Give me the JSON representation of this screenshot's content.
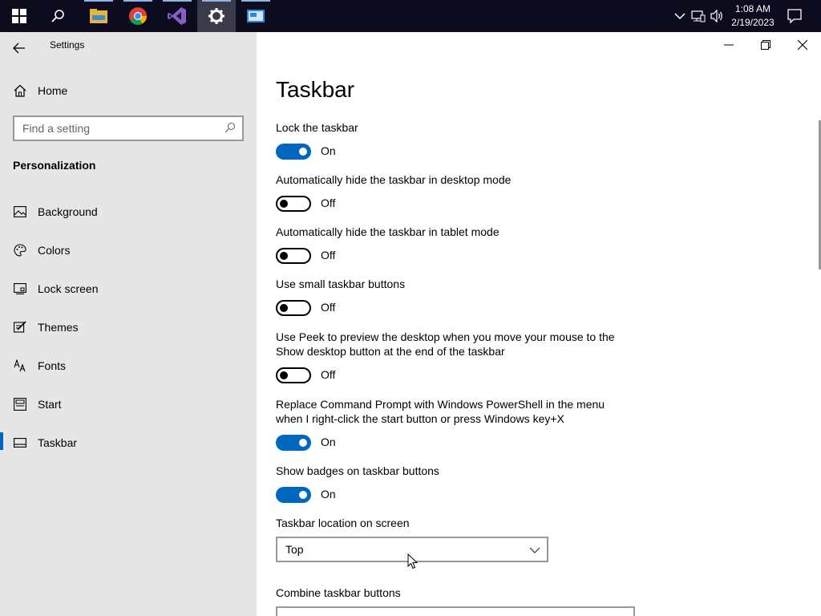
{
  "taskbar": {
    "apps": [
      {
        "icon": "windows-start-icon"
      },
      {
        "icon": "search-icon"
      },
      {
        "icon": "file-explorer-icon"
      },
      {
        "icon": "chrome-icon"
      },
      {
        "icon": "visual-studio-icon"
      },
      {
        "icon": "settings-gear-icon"
      },
      {
        "icon": "remote-desktop-icon"
      }
    ],
    "clock_time": "1:08 AM",
    "clock_date": "2/19/2023"
  },
  "window": {
    "app_title": "Settings"
  },
  "sidebar": {
    "home_label": "Home",
    "search_placeholder": "Find a setting",
    "section_title": "Personalization",
    "items": [
      {
        "label": "Background",
        "icon": "background-icon"
      },
      {
        "label": "Colors",
        "icon": "colors-palette-icon"
      },
      {
        "label": "Lock screen",
        "icon": "lock-screen-icon"
      },
      {
        "label": "Themes",
        "icon": "themes-icon"
      },
      {
        "label": "Fonts",
        "icon": "fonts-icon"
      },
      {
        "label": "Start",
        "icon": "start-icon"
      },
      {
        "label": "Taskbar",
        "icon": "taskbar-icon"
      }
    ],
    "selected": "Taskbar"
  },
  "main": {
    "title": "Taskbar",
    "settings": [
      {
        "label": "Lock the taskbar",
        "state": "On"
      },
      {
        "label": "Automatically hide the taskbar in desktop mode",
        "state": "Off"
      },
      {
        "label": "Automatically hide the taskbar in tablet mode",
        "state": "Off"
      },
      {
        "label": "Use small taskbar buttons",
        "state": "Off"
      },
      {
        "label": "Use Peek to preview the desktop when you move your mouse to the Show desktop button at the end of the taskbar",
        "state": "Off"
      },
      {
        "label": "Replace Command Prompt with Windows PowerShell in the menu when I right-click the start button or press Windows key+X",
        "state": "On"
      },
      {
        "label": "Show badges on taskbar buttons",
        "state": "On"
      }
    ],
    "location_label": "Taskbar location on screen",
    "location_value": "Top",
    "combine_label": "Combine taskbar buttons"
  },
  "colors": {
    "accent": "#0067c0",
    "taskbar_bg": "#0c0c1e",
    "sidebar_bg": "#e6e6e6"
  }
}
